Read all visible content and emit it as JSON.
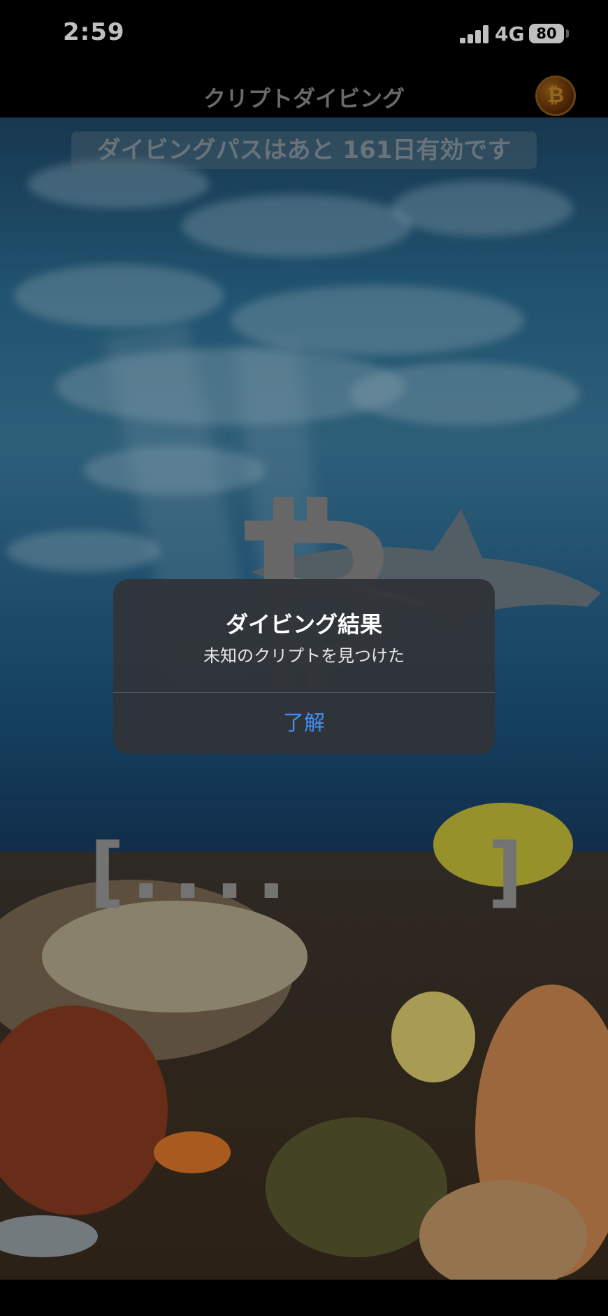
{
  "status_bar": {
    "time": "2:59",
    "network": "4G",
    "battery": "80"
  },
  "nav": {
    "title": "クリプトダイビング",
    "coin_symbol": "₿"
  },
  "banner": {
    "text": "ダイビングパスはあと 161日有効です"
  },
  "background": {
    "btc_symbol": "₿"
  },
  "crypto_code": {
    "left_bracket": "[",
    "masked": "....",
    "right_bracket": "]"
  },
  "alert": {
    "title": "ダイビング結果",
    "message": "未知のクリプトを見つけた",
    "button_label": "了解",
    "button_color": "#3f8ff5"
  }
}
